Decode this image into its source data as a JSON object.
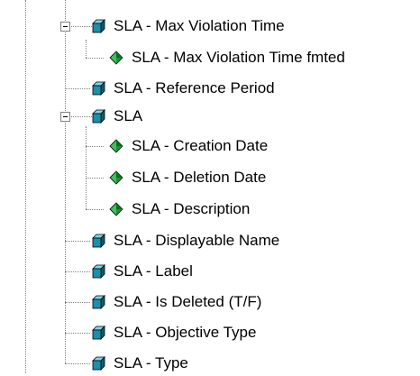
{
  "tree": {
    "nodes": [
      {
        "label": "SLA - Max Violation Time",
        "icon": "dimension-cube-icon",
        "expanded": true
      },
      {
        "label": "SLA - Max Violation Time fmted",
        "icon": "attribute-diamond-icon"
      },
      {
        "label": "SLA - Reference Period",
        "icon": "dimension-cube-icon"
      },
      {
        "label": "SLA",
        "icon": "dimension-cube-icon",
        "expanded": true
      },
      {
        "label": "SLA - Creation Date",
        "icon": "attribute-diamond-icon"
      },
      {
        "label": "SLA - Deletion Date",
        "icon": "attribute-diamond-icon"
      },
      {
        "label": "SLA - Description",
        "icon": "attribute-diamond-icon"
      },
      {
        "label": "SLA - Displayable Name",
        "icon": "dimension-cube-icon"
      },
      {
        "label": "SLA - Label",
        "icon": "dimension-cube-icon"
      },
      {
        "label": "SLA - Is Deleted (T/F)",
        "icon": "dimension-cube-icon"
      },
      {
        "label": "SLA - Objective Type",
        "icon": "dimension-cube-icon"
      },
      {
        "label": "SLA - Type",
        "icon": "dimension-cube-icon"
      }
    ]
  },
  "colors": {
    "cube_front": "#1e8fa8",
    "cube_top": "#7fd6ea",
    "cube_side": "#0b5e74",
    "diamond_light": "#3cc25a",
    "diamond_dark": "#0c6a22",
    "tree_line": "#808080"
  }
}
